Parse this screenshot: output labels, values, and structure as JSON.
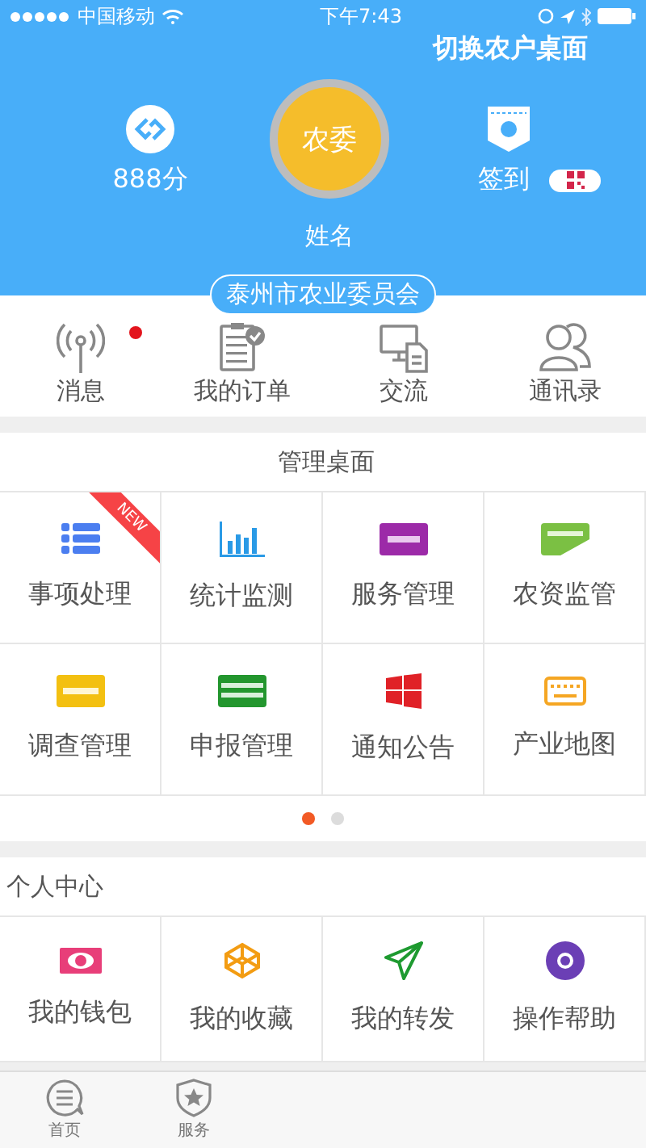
{
  "status_bar": {
    "carrier": "中国移动",
    "time": "下午7:43"
  },
  "header": {
    "switch_link": "切换农户桌面",
    "points": "888分",
    "avatar_text": "农委",
    "name": "姓名",
    "sign_in": "签到",
    "organization": "泰州市农业委员会"
  },
  "quick_actions": [
    {
      "label": "消息",
      "badge": true
    },
    {
      "label": "我的订单",
      "badge": false
    },
    {
      "label": "交流",
      "badge": false
    },
    {
      "label": "通讯录",
      "badge": false
    }
  ],
  "management": {
    "title": "管理桌面",
    "items": [
      {
        "label": "事项处理",
        "ribbon": "NEW"
      },
      {
        "label": "统计监测"
      },
      {
        "label": "服务管理"
      },
      {
        "label": "农资监管"
      },
      {
        "label": "调查管理"
      },
      {
        "label": "申报管理"
      },
      {
        "label": "通知公告"
      },
      {
        "label": "产业地图"
      }
    ],
    "pages": [
      {
        "selected": true
      },
      {
        "selected": false
      }
    ]
  },
  "personal": {
    "title": "个人中心",
    "items": [
      {
        "label": "我的钱包"
      },
      {
        "label": "我的收藏"
      },
      {
        "label": "我的转发"
      },
      {
        "label": "操作帮助"
      }
    ]
  },
  "tab_bar": [
    {
      "label": "首页"
    },
    {
      "label": "服务"
    }
  ]
}
